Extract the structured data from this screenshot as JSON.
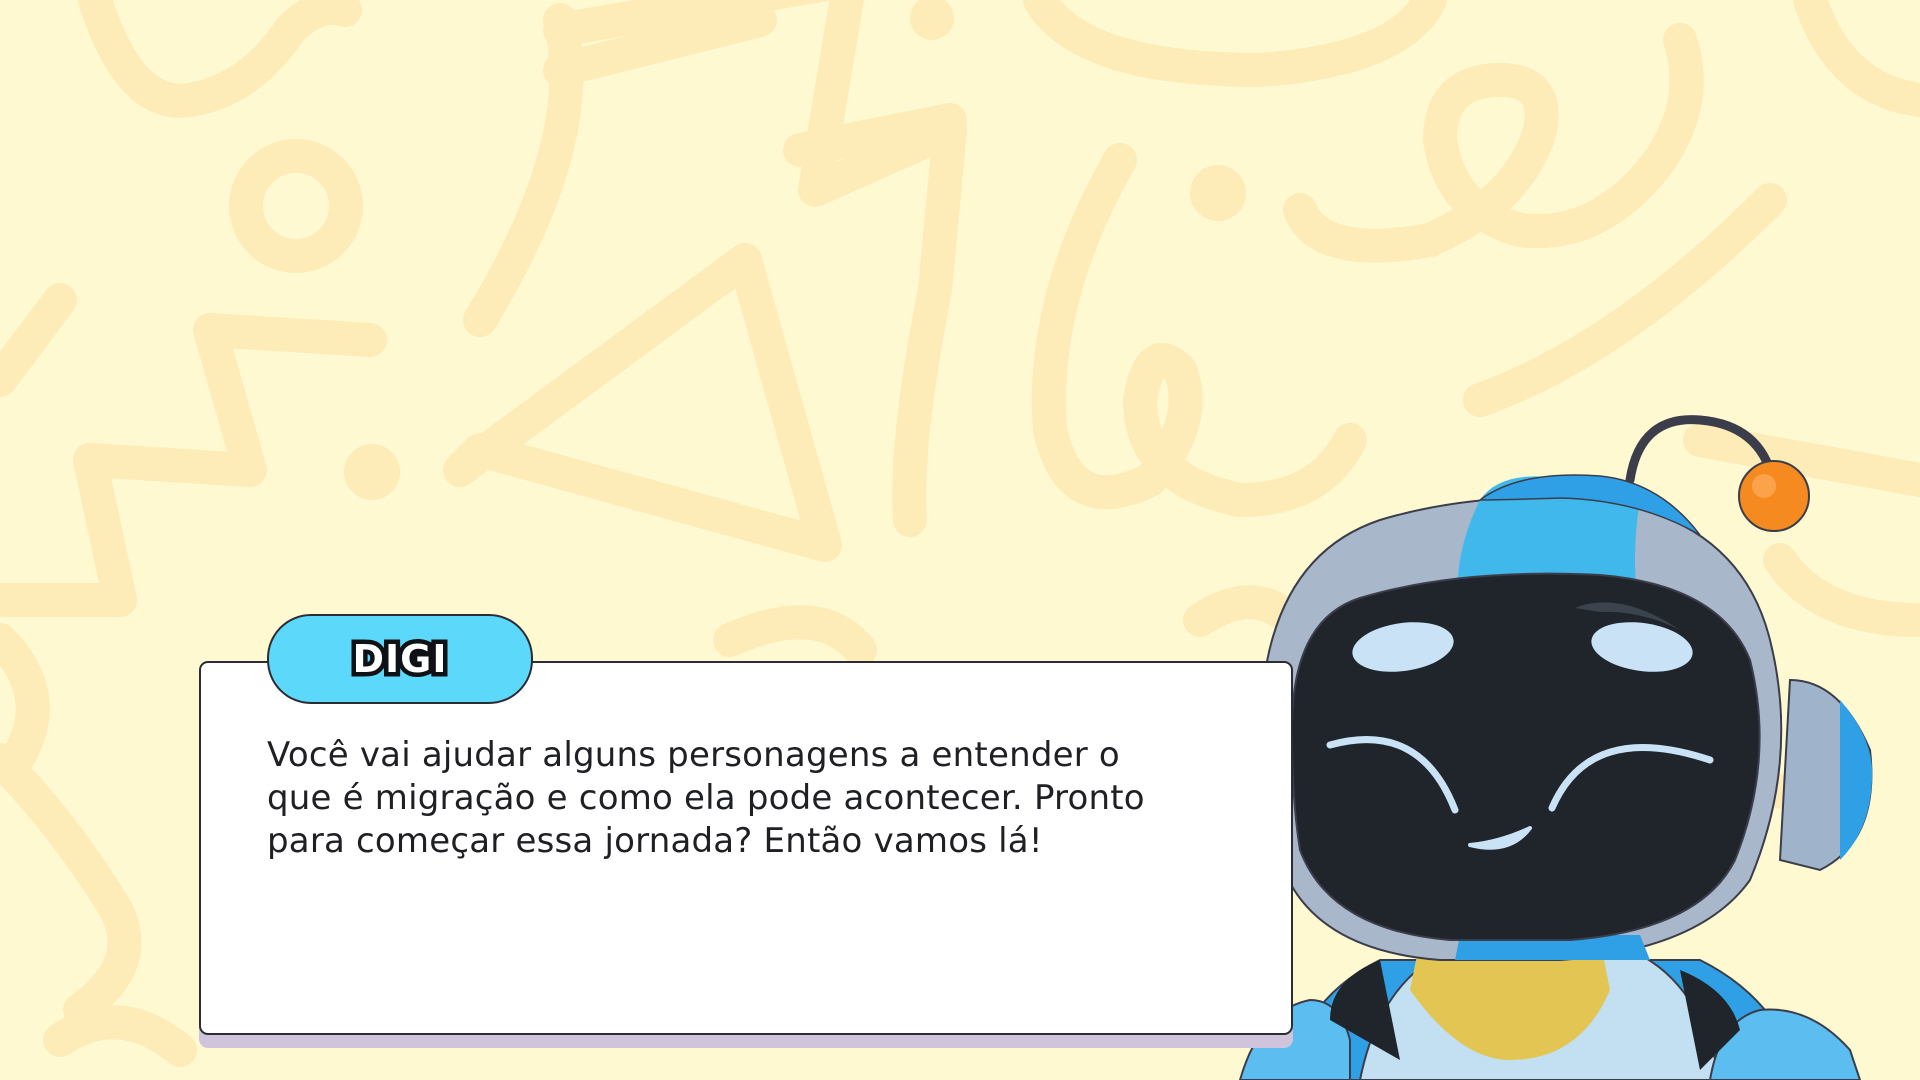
{
  "dialog": {
    "speaker": "DIGI",
    "text": "Você vai ajudar alguns personagens a entender o que é migração e como ela pode acontecer. Pronto para começar essa jornada? Então vamos lá!"
  },
  "colors": {
    "background": "#fff9d2",
    "doodle": "#fdebb8",
    "name_tag": "#5cd8fb",
    "dialog_shadow": "#cfc4dc",
    "robot_visor": "#1f252b",
    "robot_antenna_tip": "#f58a20"
  },
  "icons": {
    "character": "robot-character"
  }
}
